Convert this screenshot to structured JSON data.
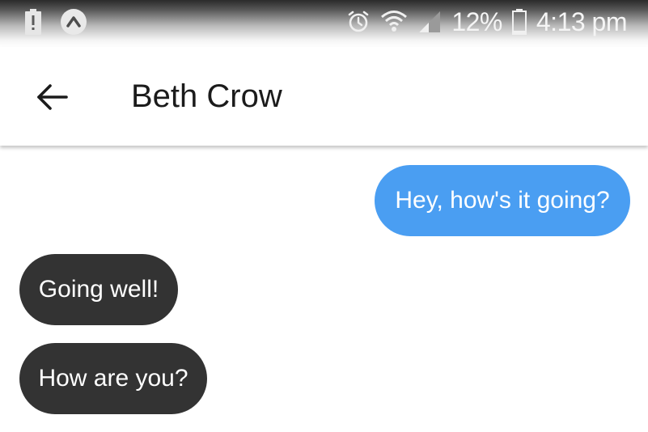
{
  "status_bar": {
    "left_icons": [
      "battery-alert-icon",
      "app-notification-icon"
    ],
    "right_icons": [
      "alarm-icon",
      "wifi-icon",
      "signal-icon",
      "battery-icon"
    ],
    "battery_percent": "12%",
    "time": "4:13 pm"
  },
  "app_bar": {
    "back_icon": "arrow-left-icon",
    "title": "Beth Crow"
  },
  "messages": [
    {
      "direction": "outgoing",
      "text": "Hey, how's it going?"
    },
    {
      "direction": "incoming",
      "text": "Going well!"
    },
    {
      "direction": "incoming",
      "text": "How are you?"
    }
  ],
  "colors": {
    "outgoing_bubble": "#4a9ef2",
    "incoming_bubble": "#333333",
    "bubble_text": "#ffffff",
    "title_text": "#1b1b1b",
    "background": "#ffffff"
  }
}
